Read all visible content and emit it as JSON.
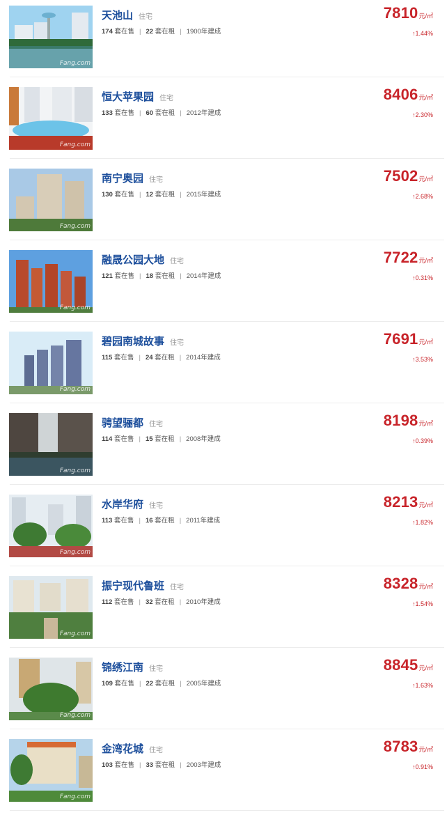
{
  "labels": {
    "for_sale": "套在售",
    "for_rent": "套在租",
    "built_suffix": "年建成",
    "unit": "元/㎡",
    "up_arrow": "↑",
    "watermark": "Fang.com"
  },
  "listings": [
    {
      "name": "天池山",
      "type": "住宅",
      "sale": "174",
      "rent": "22",
      "year": "1900",
      "price": "7810",
      "change": "1.44%",
      "theme": "lake"
    },
    {
      "name": "恒大苹果园",
      "type": "住宅",
      "sale": "133",
      "rent": "60",
      "year": "2012",
      "price": "8406",
      "change": "2.30%",
      "theme": "pool"
    },
    {
      "name": "南宁奥园",
      "type": "住宅",
      "sale": "130",
      "rent": "12",
      "year": "2015",
      "price": "7502",
      "change": "2.68%",
      "theme": "towers"
    },
    {
      "name": "融晟公园大地",
      "type": "住宅",
      "sale": "121",
      "rent": "18",
      "year": "2014",
      "price": "7722",
      "change": "0.31%",
      "theme": "red"
    },
    {
      "name": "碧园南城故事",
      "type": "住宅",
      "sale": "115",
      "rent": "24",
      "year": "2014",
      "price": "7691",
      "change": "3.53%",
      "theme": "render"
    },
    {
      "name": "骋望骊都",
      "type": "住宅",
      "sale": "114",
      "rent": "15",
      "year": "2008",
      "price": "8198",
      "change": "0.39%",
      "theme": "dark"
    },
    {
      "name": "水岸华府",
      "type": "住宅",
      "sale": "113",
      "rent": "16",
      "year": "2011",
      "price": "8213",
      "change": "1.82%",
      "theme": "trees"
    },
    {
      "name": "振宁现代鲁班",
      "type": "住宅",
      "sale": "112",
      "rent": "32",
      "year": "2010",
      "price": "8328",
      "change": "1.54%",
      "theme": "garden"
    },
    {
      "name": "锦绣江南",
      "type": "住宅",
      "sale": "109",
      "rent": "22",
      "year": "2005",
      "price": "8845",
      "change": "1.63%",
      "theme": "green"
    },
    {
      "name": "金湾花城",
      "type": "住宅",
      "sale": "103",
      "rent": "33",
      "year": "2003",
      "price": "8783",
      "change": "0.91%",
      "theme": "palm"
    }
  ]
}
